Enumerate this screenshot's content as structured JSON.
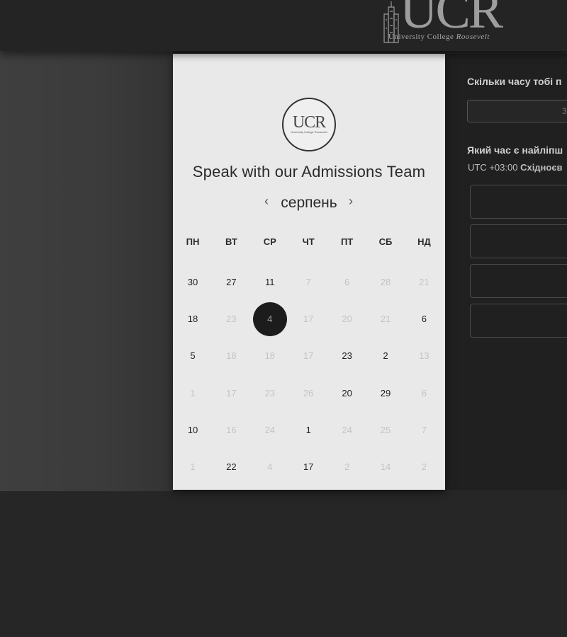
{
  "header": {
    "logo_big": "UCR",
    "logo_sub": "University College",
    "logo_sub_italic": "Roosevelt"
  },
  "calendar": {
    "round_logo_big": "UCR",
    "round_logo_sub": "University College Roosevelt",
    "title": "Speak with our Admissions Team",
    "month": "серпень",
    "prev_icon": "‹",
    "next_icon": "›",
    "weekdays": [
      "ПН",
      "ВТ",
      "СР",
      "ЧТ",
      "ПТ",
      "СБ",
      "НД"
    ],
    "rows": [
      [
        {
          "t": "30",
          "a": 1
        },
        {
          "t": "27",
          "a": 1
        },
        {
          "t": "11",
          "a": 1
        },
        {
          "t": "7",
          "a": 0
        },
        {
          "t": "6",
          "a": 0
        },
        {
          "t": "28",
          "a": 0
        },
        {
          "t": "21",
          "a": 0
        }
      ],
      [
        {
          "t": "18",
          "a": 1
        },
        {
          "t": "23",
          "a": 0
        },
        {
          "t": "4",
          "a": 1,
          "s": 1
        },
        {
          "t": "17",
          "a": 0
        },
        {
          "t": "20",
          "a": 0
        },
        {
          "t": "21",
          "a": 0
        },
        {
          "t": "6",
          "a": 1
        }
      ],
      [
        {
          "t": "5",
          "a": 1
        },
        {
          "t": "18",
          "a": 0
        },
        {
          "t": "18",
          "a": 0
        },
        {
          "t": "17",
          "a": 0
        },
        {
          "t": "23",
          "a": 1
        },
        {
          "t": "2",
          "a": 1
        },
        {
          "t": "13",
          "a": 0
        }
      ],
      [
        {
          "t": "1",
          "a": 0
        },
        {
          "t": "17",
          "a": 0
        },
        {
          "t": "23",
          "a": 0
        },
        {
          "t": "26",
          "a": 0
        },
        {
          "t": "20",
          "a": 1
        },
        {
          "t": "29",
          "a": 1
        },
        {
          "t": "6",
          "a": 0
        }
      ],
      [
        {
          "t": "10",
          "a": 1
        },
        {
          "t": "16",
          "a": 0
        },
        {
          "t": "24",
          "a": 0
        },
        {
          "t": "1",
          "a": 1
        },
        {
          "t": "24",
          "a": 0
        },
        {
          "t": "25",
          "a": 0
        },
        {
          "t": "7",
          "a": 0
        }
      ],
      [
        {
          "t": "1",
          "a": 0
        },
        {
          "t": "22",
          "a": 1
        },
        {
          "t": "4",
          "a": 0
        },
        {
          "t": "17",
          "a": 1
        },
        {
          "t": "2",
          "a": 0
        },
        {
          "t": "14",
          "a": 0
        },
        {
          "t": "2",
          "a": 0
        }
      ]
    ]
  },
  "booking": {
    "duration_question": "Скільки часу тобі п",
    "duration_value": "3",
    "time_question": "Який час є найліпш",
    "timezone_offset": "UTC +03:00",
    "timezone_name": "Східноєв",
    "slot_marks": [
      "!",
      "!",
      "!",
      "!"
    ]
  }
}
